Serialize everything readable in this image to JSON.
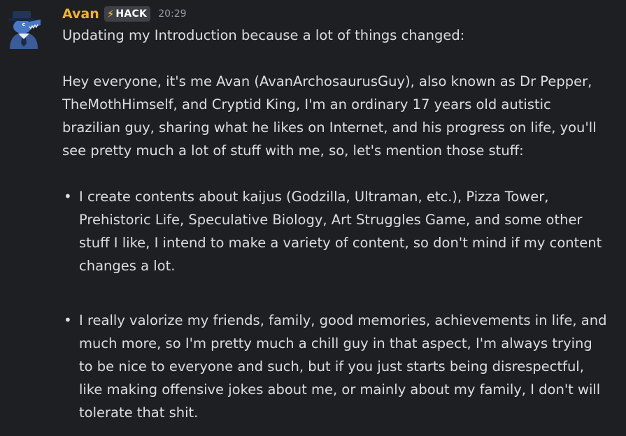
{
  "message": {
    "author": "Avan",
    "tag": {
      "icon": "lightning-bolt-icon",
      "icon_glyph": "⚡",
      "label": "HACK"
    },
    "timestamp": "20:29",
    "intro_line": "Updating my Introduction because a lot of things changed:",
    "paragraph_lines": [
      "Hey everyone, it's me Avan (AvanArchosaurusGuy), also known as Dr Pepper,",
      "TheMothHimself, and Cryptid King, I'm an ordinary 17 years old autistic",
      "brazilian guy, sharing what he likes on Internet, and his progress on life, you'll",
      "see pretty much a lot of stuff with me, so, let's mention those stuff:"
    ],
    "bullets": [
      {
        "lines": [
          "I create contents about kaijus (Godzilla, Ultraman, etc.), Pizza Tower,",
          "Prehistoric Life, Speculative Biology, Art Struggles Game, and some other",
          "stuff I like, I intend to make a variety of content, so don't mind if my content",
          "changes a lot."
        ]
      },
      {
        "lines": [
          "I really valorize my friends, family, good memories, achievements in life, and",
          "much more, so I'm pretty much a chill guy in that aspect, I'm always trying",
          "to be nice to everyone and such, but if you just starts being disrespectful,",
          "like making offensive jokes about me, or mainly about my family, I don't will",
          "tolerate that shit."
        ]
      }
    ]
  },
  "colors": {
    "background": "#1e1f22",
    "username": "#f0b232",
    "text": "#dbdee1",
    "timestamp": "#949ba4",
    "tag_bg": "#3f4147"
  }
}
